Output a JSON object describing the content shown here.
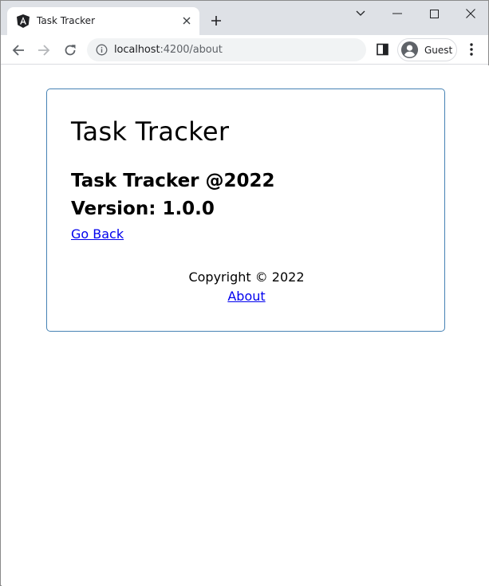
{
  "browser": {
    "tab": {
      "title": "Task Tracker",
      "favicon": "angular-icon"
    },
    "url": {
      "host": "localhost",
      "path": ":4200/about"
    },
    "profile": {
      "name": "Guest"
    }
  },
  "page": {
    "title": "Task Tracker",
    "about_heading": "Task Tracker @2022",
    "version": "Version: 1.0.0",
    "go_back": "Go Back",
    "footer": {
      "copyright": "Copyright © 2022",
      "about_link": "About"
    }
  },
  "colors": {
    "card_border": "#4682b4",
    "link": "#0000ee",
    "tabstrip_bg": "#dee1e6"
  }
}
